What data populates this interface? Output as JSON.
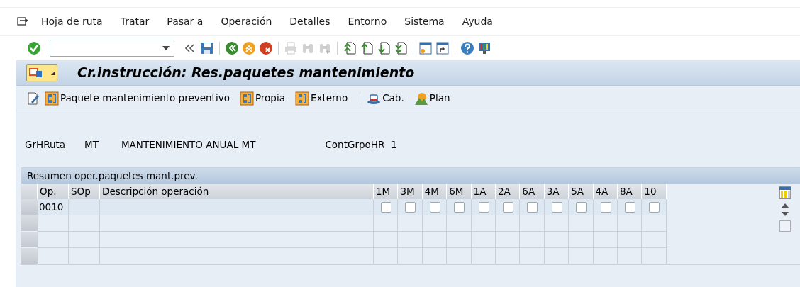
{
  "menu_bar": [
    {
      "label": "Hoja de ruta"
    },
    {
      "label": "Tratar"
    },
    {
      "label": "Pasar a"
    },
    {
      "label": "Operación"
    },
    {
      "label": "Detalles"
    },
    {
      "label": "Entorno"
    },
    {
      "label": "Sistema"
    },
    {
      "label": "Ayuda"
    }
  ],
  "system_toolbar": [
    {
      "kind": "enter",
      "disabled": false
    },
    {
      "kind": "command"
    },
    {
      "kind": "collapse",
      "disabled": false
    },
    {
      "kind": "save",
      "disabled": false
    },
    {
      "kind": "sep"
    },
    {
      "kind": "back",
      "disabled": false
    },
    {
      "kind": "exit",
      "disabled": false
    },
    {
      "kind": "cancel",
      "disabled": false
    },
    {
      "kind": "sep"
    },
    {
      "kind": "print",
      "disabled": true
    },
    {
      "kind": "find",
      "disabled": true
    },
    {
      "kind": "find-next",
      "disabled": true
    },
    {
      "kind": "sep"
    },
    {
      "kind": "first-page",
      "disabled": false
    },
    {
      "kind": "prev-page",
      "disabled": false
    },
    {
      "kind": "next-page",
      "disabled": false
    },
    {
      "kind": "last-page",
      "disabled": false
    },
    {
      "kind": "sep"
    },
    {
      "kind": "new-session",
      "disabled": false
    },
    {
      "kind": "shortcut",
      "disabled": false
    },
    {
      "kind": "sep"
    },
    {
      "kind": "help",
      "disabled": false
    },
    {
      "kind": "layout",
      "disabled": false
    }
  ],
  "title": "Cr.instrucción: Res.paquetes mantenimiento",
  "app_toolbar": [
    {
      "kind": "edit"
    },
    {
      "kind": "package",
      "label": "Paquete mantenimiento preventivo"
    },
    {
      "kind": "package",
      "label": "Propia"
    },
    {
      "kind": "package",
      "label": "Externo"
    },
    {
      "kind": "sep"
    },
    {
      "kind": "header",
      "label": "Cab."
    },
    {
      "kind": "plan",
      "label": "Plan"
    }
  ],
  "header": {
    "label": "GrHRuta",
    "group": "MT",
    "description": "MANTENIMIENTO ANUAL MT",
    "counter_label": "ContGrpoHR",
    "counter": "1"
  },
  "table": {
    "title": "Resumen oper.paquetes mant.prev.",
    "columns": [
      "Op.",
      "SOp",
      "Descripción operación"
    ],
    "package_columns": [
      "1M",
      "3M",
      "4M",
      "6M",
      "1A",
      "2A",
      "6A",
      "3A",
      "5A",
      "4A",
      "8A",
      "10"
    ],
    "rows": [
      {
        "op": "0010",
        "checks": [
          false,
          false,
          false,
          false,
          false,
          false,
          false,
          false,
          false,
          false,
          false,
          false
        ]
      }
    ]
  }
}
